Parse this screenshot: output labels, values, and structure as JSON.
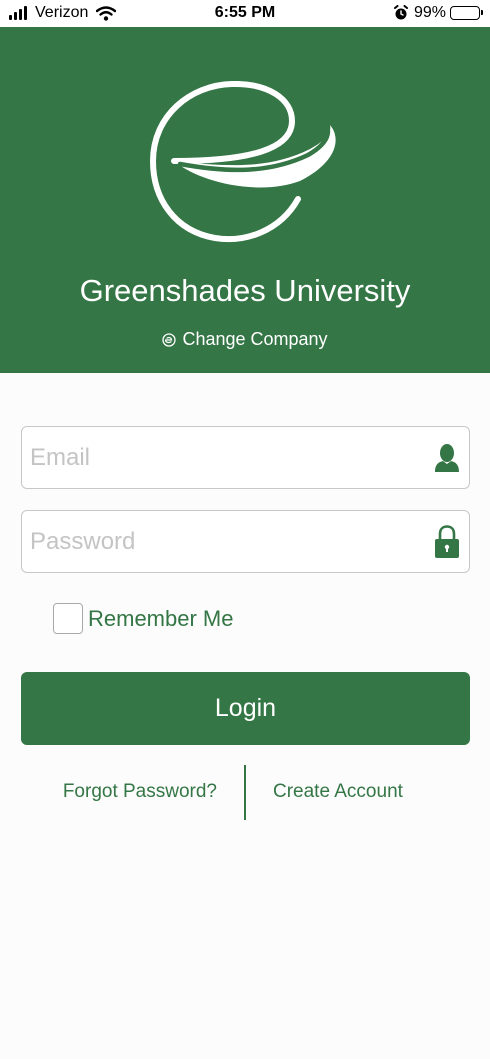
{
  "status_bar": {
    "carrier": "Verizon",
    "time": "6:55 PM",
    "battery_percent": "99%",
    "battery_level": 0.99,
    "icons": [
      "signal-icon",
      "wifi-icon",
      "alarm-icon",
      "battery-icon"
    ]
  },
  "header": {
    "logo": "greenshades-logo-icon",
    "title": "Greenshades University",
    "change_company_label": "Change Company",
    "change_company_icon": "change-company-icon"
  },
  "form": {
    "email_placeholder": "Email",
    "email_value": "",
    "email_icon": "user-icon",
    "password_placeholder": "Password",
    "password_value": "",
    "password_icon": "lock-icon",
    "remember_label": "Remember Me",
    "remember_checked": false,
    "login_label": "Login"
  },
  "links": {
    "forgot_password": "Forgot Password?",
    "create_account": "Create Account"
  },
  "colors": {
    "brand_green": "#347645",
    "background": "#fcfcfc",
    "placeholder": "#c4c4c4"
  }
}
